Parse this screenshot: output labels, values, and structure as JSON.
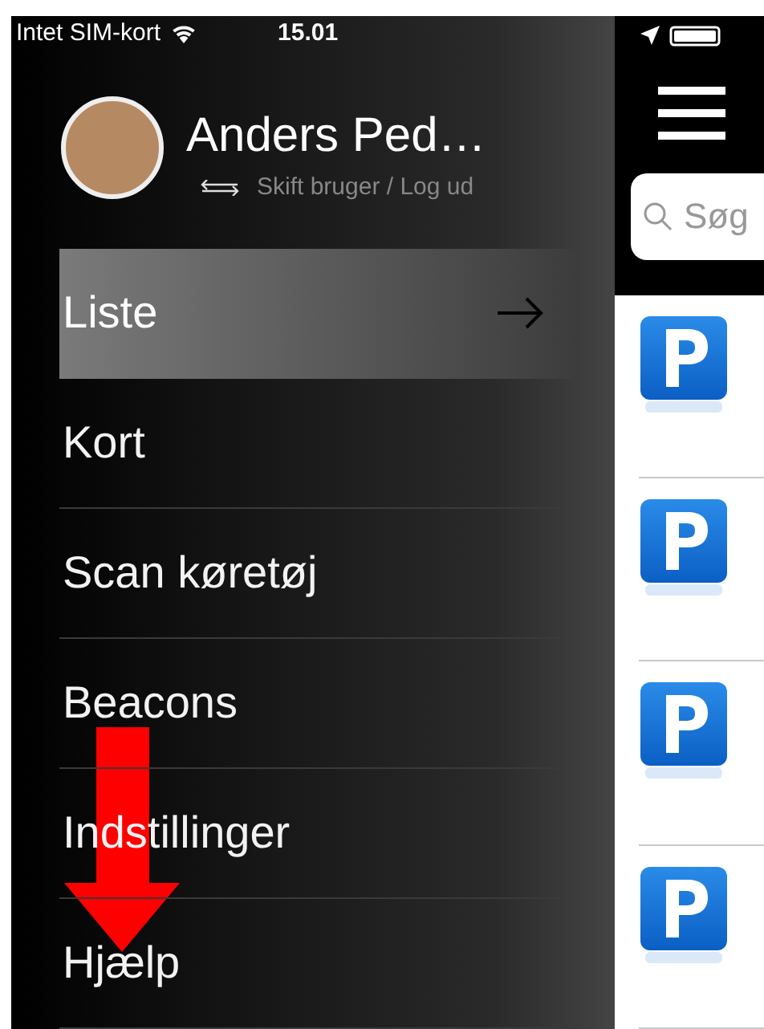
{
  "status_bar": {
    "carrier": "Intet SIM-kort",
    "time": "15.01"
  },
  "profile": {
    "name": "Anders Ped…",
    "switch_label": "Skift bruger / Log ud"
  },
  "menu": [
    {
      "label": "Liste",
      "selected": true
    },
    {
      "label": "Kort",
      "selected": false
    },
    {
      "label": "Scan køretøj",
      "selected": false
    },
    {
      "label": "Beacons",
      "selected": false
    },
    {
      "label": "Indstillinger",
      "selected": false
    },
    {
      "label": "Hjælp",
      "selected": false
    }
  ],
  "search": {
    "placeholder": "Søg"
  }
}
